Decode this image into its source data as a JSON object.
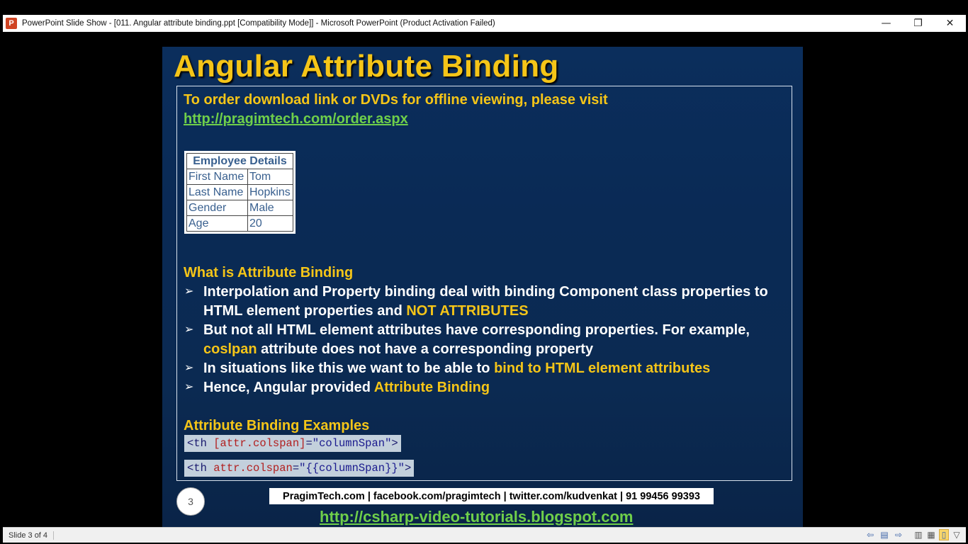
{
  "window": {
    "app_icon_letter": "P",
    "title": "PowerPoint Slide Show - [011. Angular attribute binding.ppt [Compatibility Mode]] - Microsoft PowerPoint (Product Activation Failed)",
    "minimize": "—",
    "restore": "❐",
    "close": "✕"
  },
  "slide": {
    "title": "Angular Attribute Binding",
    "order_text": "To order download link or DVDs for offline viewing, please visit",
    "order_link": "http://pragimtech.com/order.aspx",
    "table": {
      "header": "Employee Details",
      "rows": [
        {
          "label": "First Name",
          "value": "Tom"
        },
        {
          "label": "Last Name",
          "value": "Hopkins"
        },
        {
          "label": "Gender",
          "value": "Male"
        },
        {
          "label": "Age",
          "value": "20"
        }
      ]
    },
    "section_heading": "What is Attribute Binding",
    "bullets": [
      {
        "line1": "Interpolation and  Property binding deal with binding Component class properties to",
        "line2_white": "HTML element properties and ",
        "line2_yellow": "NOT ATTRIBUTES"
      },
      {
        "line1": "But not all HTML element attributes have corresponding properties. For example,",
        "line2_yellow": "coslpan",
        "line2_white": " attribute does not have a corresponding property"
      },
      {
        "white": "In situations like this we want to be able to ",
        "yellow": "bind to HTML element attributes"
      },
      {
        "white": "Hence, Angular provided ",
        "yellow": "Attribute Binding"
      }
    ],
    "examples_heading": "Attribute Binding  Examples",
    "code1": {
      "tag": "<th ",
      "attr": "[attr.colspan]",
      "eq": "=",
      "str": "\"columnSpan\"",
      "end": ">"
    },
    "code2": {
      "tag": "<th ",
      "attr": "attr.colspan",
      "eq": "=",
      "str": "\"{{columnSpan}}\"",
      "end": ">"
    },
    "slide_number": "3",
    "footer_bar": "PragimTech.com | facebook.com/pragimtech  | twitter.com/kudvenkat  | 91 99456 99393",
    "footer_link": "http://csharp-video-tutorials.blogspot.com"
  },
  "statusbar": {
    "slide_indicator": "Slide 3 of 4",
    "icons": [
      "previous-icon",
      "notes-icon",
      "next-icon",
      "normal-view-icon",
      "slide-sorter-icon",
      "reading-view-icon",
      "slideshow-icon"
    ]
  }
}
